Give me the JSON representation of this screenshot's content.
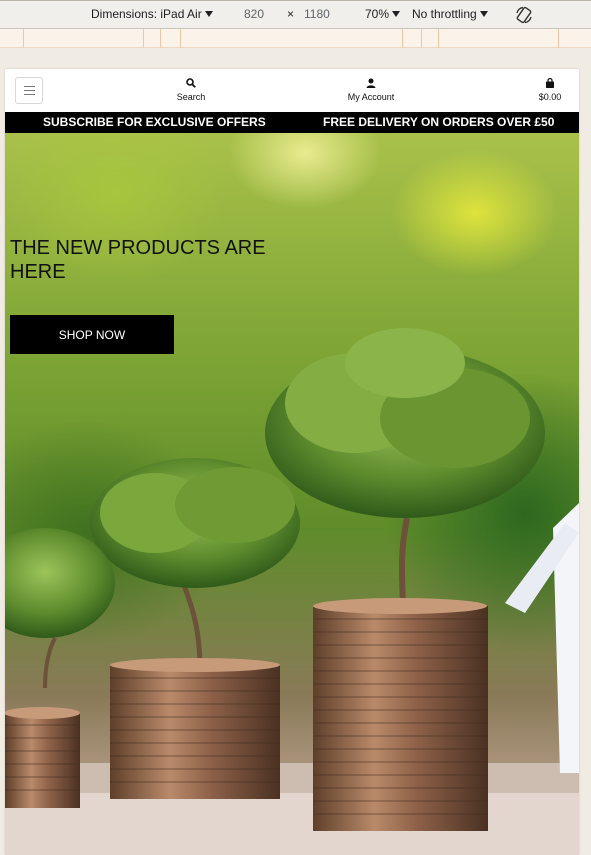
{
  "devtools": {
    "dimensions_label": "Dimensions: iPad Air",
    "width_value": "820",
    "times": "×",
    "height_value": "1180",
    "zoom": "70%",
    "throttling": "No throttling",
    "rotate_icon": "rotate-icon"
  },
  "header": {
    "menu_icon": "hamburger-icon",
    "search_label": "Search",
    "account_label": "My Account",
    "cart_total": "$0.00"
  },
  "promo": {
    "left_text": "SUBSCRIBE FOR EXCLUSIVE OFFERS",
    "right_text": "FREE DELIVERY ON ORDERS OVER £50"
  },
  "hero": {
    "title": "THE NEW PRODUCTS ARE HERE",
    "cta_label": "SHOP NOW"
  }
}
